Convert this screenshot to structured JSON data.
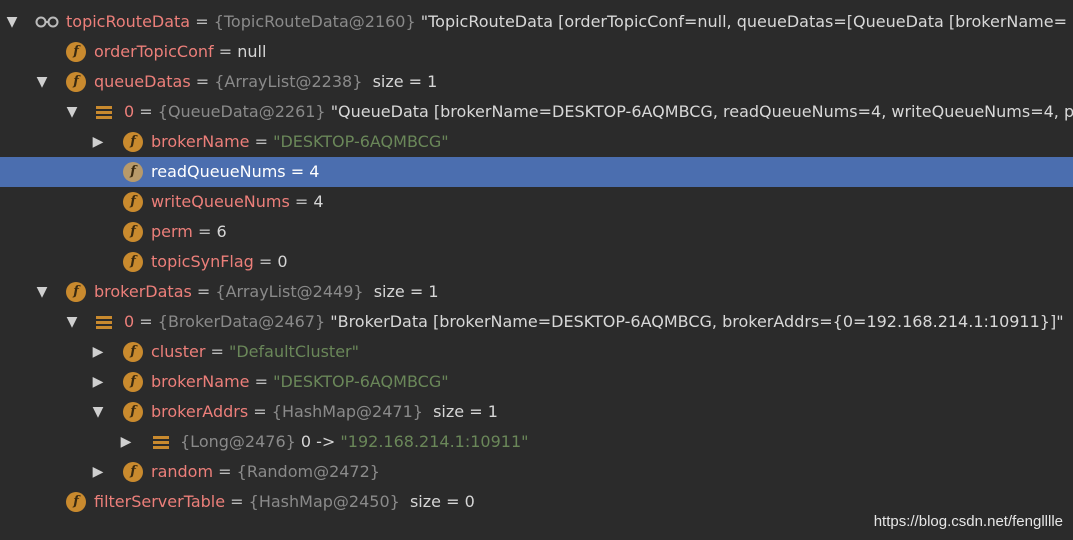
{
  "rows": [
    {
      "name": "topicRouteData",
      "eq": " = ",
      "ref": "{TopicRouteData@2160}",
      "desc": " \"TopicRouteData [orderTopicConf=null, queueDatas=[QueueData [brokerName="
    },
    {
      "name": "orderTopicConf",
      "eq": " = ",
      "val": "null"
    },
    {
      "name": "queueDatas",
      "eq": " = ",
      "ref": "{ArrayList@2238}",
      "size": "  size = 1"
    },
    {
      "name": "0",
      "eq": " = ",
      "ref": "{QueueData@2261}",
      "desc": " \"QueueData [brokerName=DESKTOP-6AQMBCG, readQueueNums=4, writeQueueNums=4, p"
    },
    {
      "name": "brokerName",
      "eq": " = ",
      "str": "\"DESKTOP-6AQMBCG\""
    },
    {
      "name": "readQueueNums",
      "eq": " = ",
      "val": "4"
    },
    {
      "name": "writeQueueNums",
      "eq": " = ",
      "val": "4"
    },
    {
      "name": "perm",
      "eq": " = ",
      "val": "6"
    },
    {
      "name": "topicSynFlag",
      "eq": " = ",
      "val": "0"
    },
    {
      "name": "brokerDatas",
      "eq": " = ",
      "ref": "{ArrayList@2449}",
      "size": "  size = 1"
    },
    {
      "name": "0",
      "eq": " = ",
      "ref": "{BrokerData@2467}",
      "desc": " \"BrokerData [brokerName=DESKTOP-6AQMBCG, brokerAddrs={0=192.168.214.1:10911}]\""
    },
    {
      "name": "cluster",
      "eq": " = ",
      "str": "\"DefaultCluster\""
    },
    {
      "name": "brokerName",
      "eq": " = ",
      "str": "\"DESKTOP-6AQMBCG\""
    },
    {
      "name": "brokerAddrs",
      "eq": " = ",
      "ref": "{HashMap@2471}",
      "size": "  size = 1"
    },
    {
      "ref": "{Long@2476}",
      "val": " 0 -> ",
      "str": "\"192.168.214.1:10911\""
    },
    {
      "name": "random",
      "eq": " = ",
      "ref": "{Random@2472}"
    },
    {
      "name": "filterServerTable",
      "eq": " = ",
      "ref": "{HashMap@2450}",
      "size": "  size = 0"
    }
  ],
  "watermark": "https://blog.csdn.net/fenglllle",
  "icons": {
    "root": "watch-glasses-icon",
    "field": "field-f-icon",
    "list_entry": "list-entry-icon",
    "expand": "chevron-right-icon",
    "collapse": "chevron-down-icon"
  },
  "colors": {
    "background": "#2b2b2b",
    "selection": "#4b6eaf",
    "field_name": "#ec7f7a",
    "string_value": "#6a8759",
    "reference": "#8a8a8a",
    "field_icon": "#c98a2e"
  }
}
